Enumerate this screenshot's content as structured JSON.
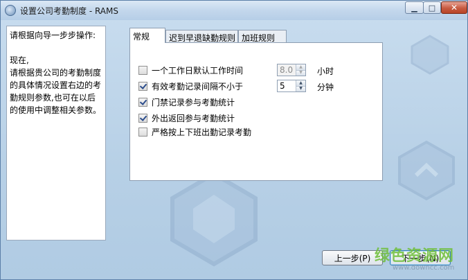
{
  "window": {
    "title": "设置公司考勤制度 - RAMS"
  },
  "left_panel": {
    "heading": "请根据向导一步步操作:",
    "body_lines": [
      "现在,",
      "请根据贵公司的考勤制度",
      "的具体情况设置右边的考",
      "勤规则参数,也可在以后",
      "的使用中调整相关参数。"
    ]
  },
  "tabs": [
    {
      "label": "常规",
      "active": true
    },
    {
      "label": "迟到早退缺勤规则",
      "active": false
    },
    {
      "label": "加班规则",
      "active": false
    }
  ],
  "settings": {
    "workday_default": {
      "label": "一个工作日默认工作时间",
      "checked": false,
      "value": "8.0",
      "unit": "小时",
      "enabled": false
    },
    "min_interval": {
      "label": "有效考勤记录间隔不小于",
      "checked": true,
      "value": "5",
      "unit": "分钟",
      "enabled": true
    },
    "access_records": {
      "label": "门禁记录参与考勤统计",
      "checked": true
    },
    "outing_records": {
      "label": "外出返回参与考勤统计",
      "checked": true
    },
    "strict_shift": {
      "label": "严格按上下班出勤记录考勤",
      "checked": false
    }
  },
  "buttons": {
    "prev": "上一步(P)",
    "next": "下一步(N)"
  },
  "watermark": {
    "logo_text": "绿色资源网",
    "url": "www.downcc.com"
  },
  "colors": {
    "background": "#bcd4e8",
    "panel": "#ffffff",
    "close_button": "#c75a40",
    "watermark": "#6fbf3a"
  }
}
